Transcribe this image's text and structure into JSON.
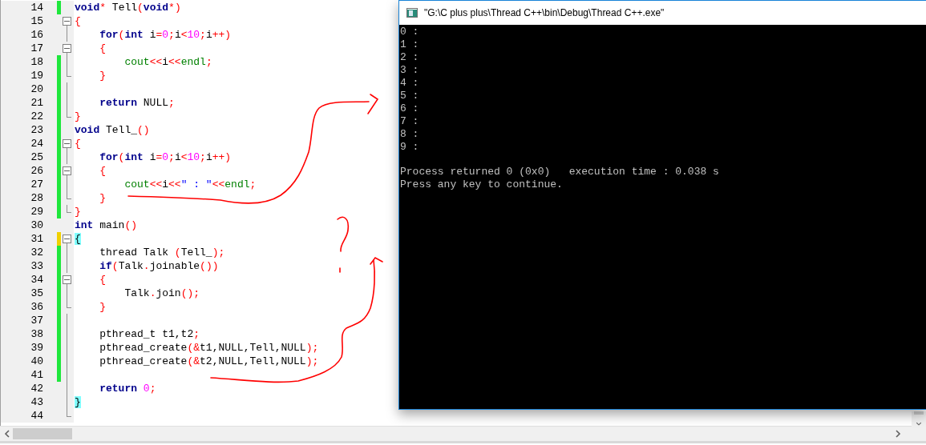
{
  "editor": {
    "lines": [
      {
        "number": "14",
        "color": "#1ee73c",
        "foldable": false,
        "in_fold": false,
        "fold_end": false,
        "tokens": [
          {
            "kind": "keyword",
            "text": "void"
          },
          {
            "kind": "operator",
            "text": "*"
          },
          {
            "kind": "plain",
            "text": " Tell"
          },
          {
            "kind": "operator",
            "text": "("
          },
          {
            "kind": "keyword",
            "text": "void"
          },
          {
            "kind": "operator",
            "text": "*)"
          }
        ]
      },
      {
        "number": "15",
        "foldable": true,
        "in_fold": false,
        "fold_end": false,
        "tokens": [
          {
            "kind": "operator",
            "text": "{"
          }
        ]
      },
      {
        "number": "16",
        "foldable": false,
        "in_fold": true,
        "fold_end": false,
        "tokens": [
          {
            "kind": "keyword",
            "text": "    for"
          },
          {
            "kind": "operator",
            "text": "("
          },
          {
            "kind": "keyword",
            "text": "int"
          },
          {
            "kind": "plain",
            "text": " i"
          },
          {
            "kind": "operator",
            "text": "="
          },
          {
            "kind": "number",
            "text": "0"
          },
          {
            "kind": "operator",
            "text": ";"
          },
          {
            "kind": "plain",
            "text": "i"
          },
          {
            "kind": "operator",
            "text": "<"
          },
          {
            "kind": "number",
            "text": "10"
          },
          {
            "kind": "operator",
            "text": ";"
          },
          {
            "kind": "plain",
            "text": "i"
          },
          {
            "kind": "operator",
            "text": "++)"
          }
        ]
      },
      {
        "number": "17",
        "foldable": true,
        "in_fold": false,
        "fold_end": false,
        "tokens": [
          {
            "kind": "operator",
            "text": "    {"
          }
        ]
      },
      {
        "number": "18",
        "color": "#1ee73c",
        "foldable": false,
        "in_fold": true,
        "fold_end": false,
        "tokens": [
          {
            "kind": "library",
            "text": "        cout"
          },
          {
            "kind": "operator",
            "text": "<<"
          },
          {
            "kind": "plain",
            "text": "i"
          },
          {
            "kind": "operator",
            "text": "<<"
          },
          {
            "kind": "library",
            "text": "endl"
          },
          {
            "kind": "operator",
            "text": ";"
          }
        ]
      },
      {
        "number": "19",
        "color": "#1ee73c",
        "foldable": false,
        "in_fold": false,
        "fold_end": true,
        "tokens": [
          {
            "kind": "operator",
            "text": "    }"
          }
        ]
      },
      {
        "number": "20",
        "color": "#1ee73c",
        "foldable": false,
        "in_fold": true,
        "fold_end": false
      },
      {
        "number": "21",
        "color": "#1ee73c",
        "foldable": false,
        "in_fold": true,
        "fold_end": false,
        "tokens": [
          {
            "kind": "keyword",
            "text": "    return"
          },
          {
            "kind": "plain",
            "text": " NULL"
          },
          {
            "kind": "operator",
            "text": ";"
          }
        ]
      },
      {
        "number": "22",
        "color": "#1ee73c",
        "foldable": false,
        "in_fold": false,
        "fold_end": true,
        "tokens": [
          {
            "kind": "operator",
            "text": "}"
          }
        ]
      },
      {
        "number": "23",
        "color": "#1ee73c",
        "foldable": false,
        "in_fold": false,
        "fold_end": false,
        "tokens": [
          {
            "kind": "keyword",
            "text": "void"
          },
          {
            "kind": "plain",
            "text": " Tell_"
          },
          {
            "kind": "operator",
            "text": "()"
          }
        ]
      },
      {
        "number": "24",
        "color": "#1ee73c",
        "foldable": true,
        "in_fold": false,
        "fold_end": false,
        "tokens": [
          {
            "kind": "operator",
            "text": "{"
          }
        ]
      },
      {
        "number": "25",
        "color": "#1ee73c",
        "foldable": false,
        "in_fold": true,
        "fold_end": false,
        "tokens": [
          {
            "kind": "keyword",
            "text": "    for"
          },
          {
            "kind": "operator",
            "text": "("
          },
          {
            "kind": "keyword",
            "text": "int"
          },
          {
            "kind": "plain",
            "text": " i"
          },
          {
            "kind": "operator",
            "text": "="
          },
          {
            "kind": "number",
            "text": "0"
          },
          {
            "kind": "operator",
            "text": ";"
          },
          {
            "kind": "plain",
            "text": "i"
          },
          {
            "kind": "operator",
            "text": "<"
          },
          {
            "kind": "number",
            "text": "10"
          },
          {
            "kind": "operator",
            "text": ";"
          },
          {
            "kind": "plain",
            "text": "i"
          },
          {
            "kind": "operator",
            "text": "++)"
          }
        ]
      },
      {
        "number": "26",
        "color": "#1ee73c",
        "foldable": true,
        "in_fold": false,
        "fold_end": false,
        "tokens": [
          {
            "kind": "operator",
            "text": "    {"
          }
        ]
      },
      {
        "number": "27",
        "color": "#1ee73c",
        "foldable": false,
        "in_fold": true,
        "fold_end": false,
        "tokens": [
          {
            "kind": "library",
            "text": "        cout"
          },
          {
            "kind": "operator",
            "text": "<<"
          },
          {
            "kind": "plain",
            "text": "i"
          },
          {
            "kind": "operator",
            "text": "<<"
          },
          {
            "kind": "string",
            "text": "\" : \""
          },
          {
            "kind": "operator",
            "text": "<<"
          },
          {
            "kind": "library",
            "text": "endl"
          },
          {
            "kind": "operator",
            "text": ";"
          }
        ]
      },
      {
        "number": "28",
        "color": "#1ee73c",
        "foldable": false,
        "in_fold": false,
        "fold_end": true,
        "tokens": [
          {
            "kind": "operator",
            "text": "    }"
          }
        ]
      },
      {
        "number": "29",
        "color": "#1ee73c",
        "foldable": false,
        "in_fold": false,
        "fold_end": true,
        "tokens": [
          {
            "kind": "operator",
            "text": "}"
          }
        ]
      },
      {
        "number": "30",
        "foldable": false,
        "in_fold": false,
        "fold_end": false,
        "tokens": [
          {
            "kind": "keyword",
            "text": "int"
          },
          {
            "kind": "plain",
            "text": " main"
          },
          {
            "kind": "operator",
            "text": "()"
          }
        ]
      },
      {
        "number": "31",
        "color": "#f0d000",
        "foldable": true,
        "in_fold": false,
        "fold_end": false,
        "tokens": [
          {
            "kind": "brace_match",
            "text": "{"
          }
        ]
      },
      {
        "number": "32",
        "color": "#1ee73c",
        "foldable": false,
        "in_fold": true,
        "fold_end": false,
        "tokens": [
          {
            "kind": "plain",
            "text": "    thread Talk "
          },
          {
            "kind": "operator",
            "text": "("
          },
          {
            "kind": "plain",
            "text": "Tell_"
          },
          {
            "kind": "operator",
            "text": ");"
          }
        ]
      },
      {
        "number": "33",
        "color": "#1ee73c",
        "foldable": false,
        "in_fold": true,
        "fold_end": false,
        "tokens": [
          {
            "kind": "keyword",
            "text": "    if"
          },
          {
            "kind": "operator",
            "text": "("
          },
          {
            "kind": "plain",
            "text": "Talk"
          },
          {
            "kind": "operator",
            "text": "."
          },
          {
            "kind": "plain",
            "text": "joinable"
          },
          {
            "kind": "operator",
            "text": "())"
          }
        ]
      },
      {
        "number": "34",
        "color": "#1ee73c",
        "foldable": true,
        "in_fold": false,
        "fold_end": false,
        "tokens": [
          {
            "kind": "operator",
            "text": "    {"
          }
        ]
      },
      {
        "number": "35",
        "color": "#1ee73c",
        "foldable": false,
        "in_fold": true,
        "fold_end": false,
        "tokens": [
          {
            "kind": "plain",
            "text": "        Talk"
          },
          {
            "kind": "operator",
            "text": "."
          },
          {
            "kind": "plain",
            "text": "join"
          },
          {
            "kind": "operator",
            "text": "();"
          }
        ]
      },
      {
        "number": "36",
        "color": "#1ee73c",
        "foldable": false,
        "in_fold": false,
        "fold_end": true,
        "tokens": [
          {
            "kind": "operator",
            "text": "    }"
          }
        ]
      },
      {
        "number": "37",
        "color": "#1ee73c",
        "foldable": false,
        "in_fold": true,
        "fold_end": false
      },
      {
        "number": "38",
        "color": "#1ee73c",
        "foldable": false,
        "in_fold": true,
        "fold_end": false,
        "tokens": [
          {
            "kind": "plain",
            "text": "    pthread_t t1,t2"
          },
          {
            "kind": "operator",
            "text": ";"
          }
        ]
      },
      {
        "number": "39",
        "color": "#1ee73c",
        "foldable": false,
        "in_fold": true,
        "fold_end": false,
        "tokens": [
          {
            "kind": "plain",
            "text": "    pthread_create"
          },
          {
            "kind": "operator",
            "text": "(&"
          },
          {
            "kind": "plain",
            "text": "t1,NULL,Tell,NULL"
          },
          {
            "kind": "operator",
            "text": ");"
          }
        ]
      },
      {
        "number": "40",
        "color": "#1ee73c",
        "foldable": false,
        "in_fold": true,
        "fold_end": false,
        "tokens": [
          {
            "kind": "plain",
            "text": "    pthread_create"
          },
          {
            "kind": "operator",
            "text": "(&"
          },
          {
            "kind": "plain",
            "text": "t2,NULL,Tell,NULL"
          },
          {
            "kind": "operator",
            "text": ");"
          }
        ]
      },
      {
        "number": "41",
        "color": "#1ee73c",
        "foldable": false,
        "in_fold": true,
        "fold_end": false
      },
      {
        "number": "42",
        "foldable": false,
        "in_fold": true,
        "fold_end": false,
        "tokens": [
          {
            "kind": "keyword",
            "text": "    return"
          },
          {
            "kind": "number",
            "text": " 0"
          },
          {
            "kind": "operator",
            "text": ";"
          }
        ]
      },
      {
        "number": "43",
        "foldable": false,
        "in_fold": true,
        "fold_end": false,
        "tokens": [
          {
            "kind": "brace_match",
            "text": "}"
          }
        ]
      },
      {
        "number": "44",
        "foldable": false,
        "in_fold": false,
        "fold_end": true
      }
    ]
  },
  "console": {
    "title": "\"G:\\C plus plus\\Thread C++\\bin\\Debug\\Thread C++.exe\"",
    "output": [
      "0 :",
      "1 :",
      "2 :",
      "3 :",
      "4 :",
      "5 :",
      "6 :",
      "7 :",
      "8 :",
      "9 :"
    ],
    "footer": [
      "Process returned 0 (0x0)   execution time : 0.038 s",
      "Press any key to continue."
    ]
  }
}
